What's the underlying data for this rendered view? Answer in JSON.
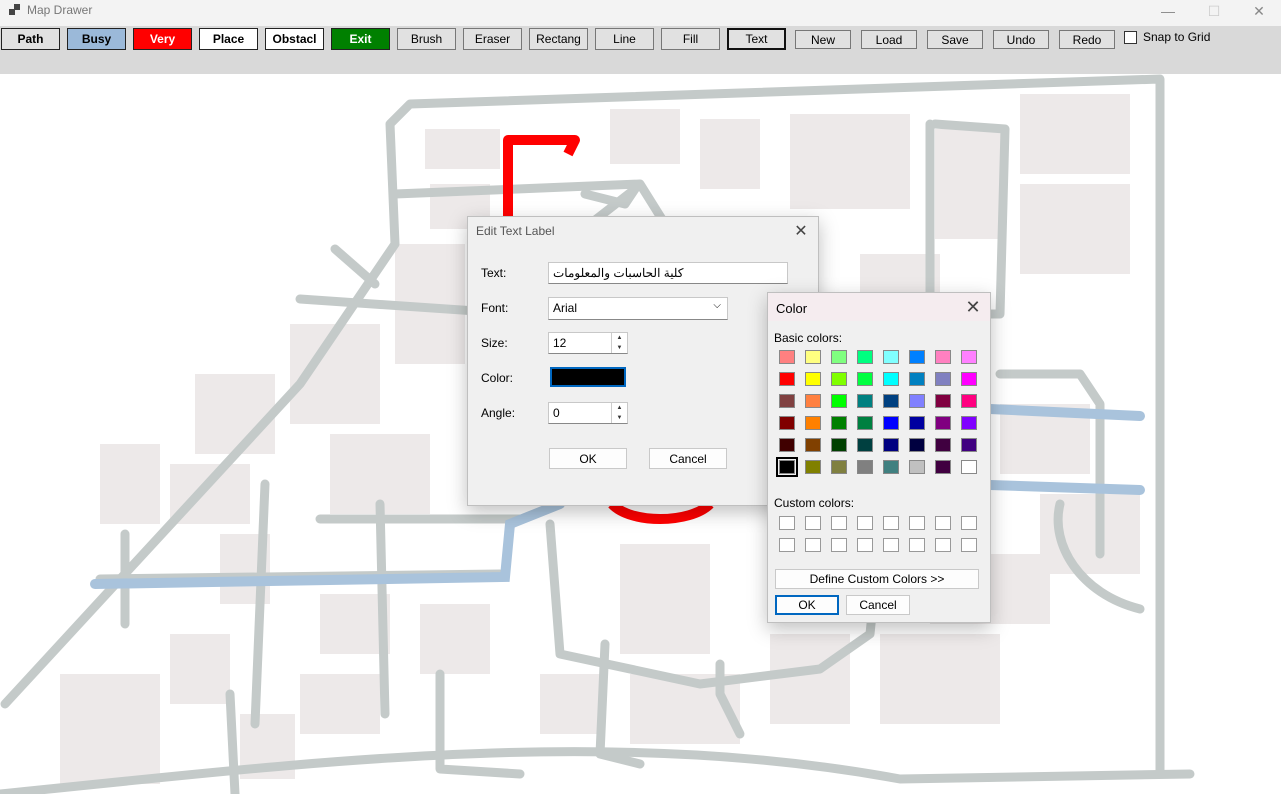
{
  "window": {
    "title": "Map Drawer",
    "minimize": "—",
    "maximize": "☐",
    "close": "✕"
  },
  "toolbar": {
    "path": "Path",
    "busy": "Busy",
    "very": "Very",
    "place": "Place",
    "obstacle": "Obstacl",
    "exit": "Exit",
    "brush": "Brush",
    "eraser": "Eraser",
    "rectangle": "Rectang",
    "line": "Line",
    "fill": "Fill",
    "text": "Text",
    "new": "New",
    "load": "Load",
    "save": "Save",
    "undo": "Undo",
    "redo": "Redo",
    "snap_label": "Snap to Grid",
    "snap_checked": false,
    "colors": {
      "busy": "#9bb9d9",
      "very": "#ff0000",
      "exit": "#008000"
    }
  },
  "edit_dialog": {
    "title": "Edit Text Label",
    "text_label": "Text:",
    "text_value": "كلية الحاسبات والمعلومات",
    "font_label": "Font:",
    "font_value": "Arial",
    "size_label": "Size:",
    "size_value": "12",
    "color_label": "Color:",
    "color_value": "#000000",
    "angle_label": "Angle:",
    "angle_value": "0",
    "ok": "OK",
    "cancel": "Cancel"
  },
  "color_dialog": {
    "title": "Color",
    "basic_label": "Basic colors:",
    "custom_label": "Custom colors:",
    "define_button": "Define Custom Colors >>",
    "ok": "OK",
    "cancel": "Cancel",
    "selected_color": "#000000",
    "basic_colors": [
      [
        "#ff8080",
        "#ffff80",
        "#80ff80",
        "#00ff80",
        "#80ffff",
        "#0080ff",
        "#ff80c0",
        "#ff80ff"
      ],
      [
        "#ff0000",
        "#ffff00",
        "#80ff00",
        "#00ff40",
        "#00ffff",
        "#0080c0",
        "#8080c0",
        "#ff00ff"
      ],
      [
        "#804040",
        "#ff8040",
        "#00ff00",
        "#008080",
        "#004080",
        "#8080ff",
        "#800040",
        "#ff0080"
      ],
      [
        "#800000",
        "#ff8000",
        "#008000",
        "#008040",
        "#0000ff",
        "#0000a0",
        "#800080",
        "#8000ff"
      ],
      [
        "#400000",
        "#804000",
        "#004000",
        "#004040",
        "#000080",
        "#000040",
        "#400040",
        "#400080"
      ],
      [
        "#000000",
        "#808000",
        "#808040",
        "#808080",
        "#408080",
        "#c0c0c0",
        "#400040",
        "#ffffff"
      ]
    ]
  }
}
